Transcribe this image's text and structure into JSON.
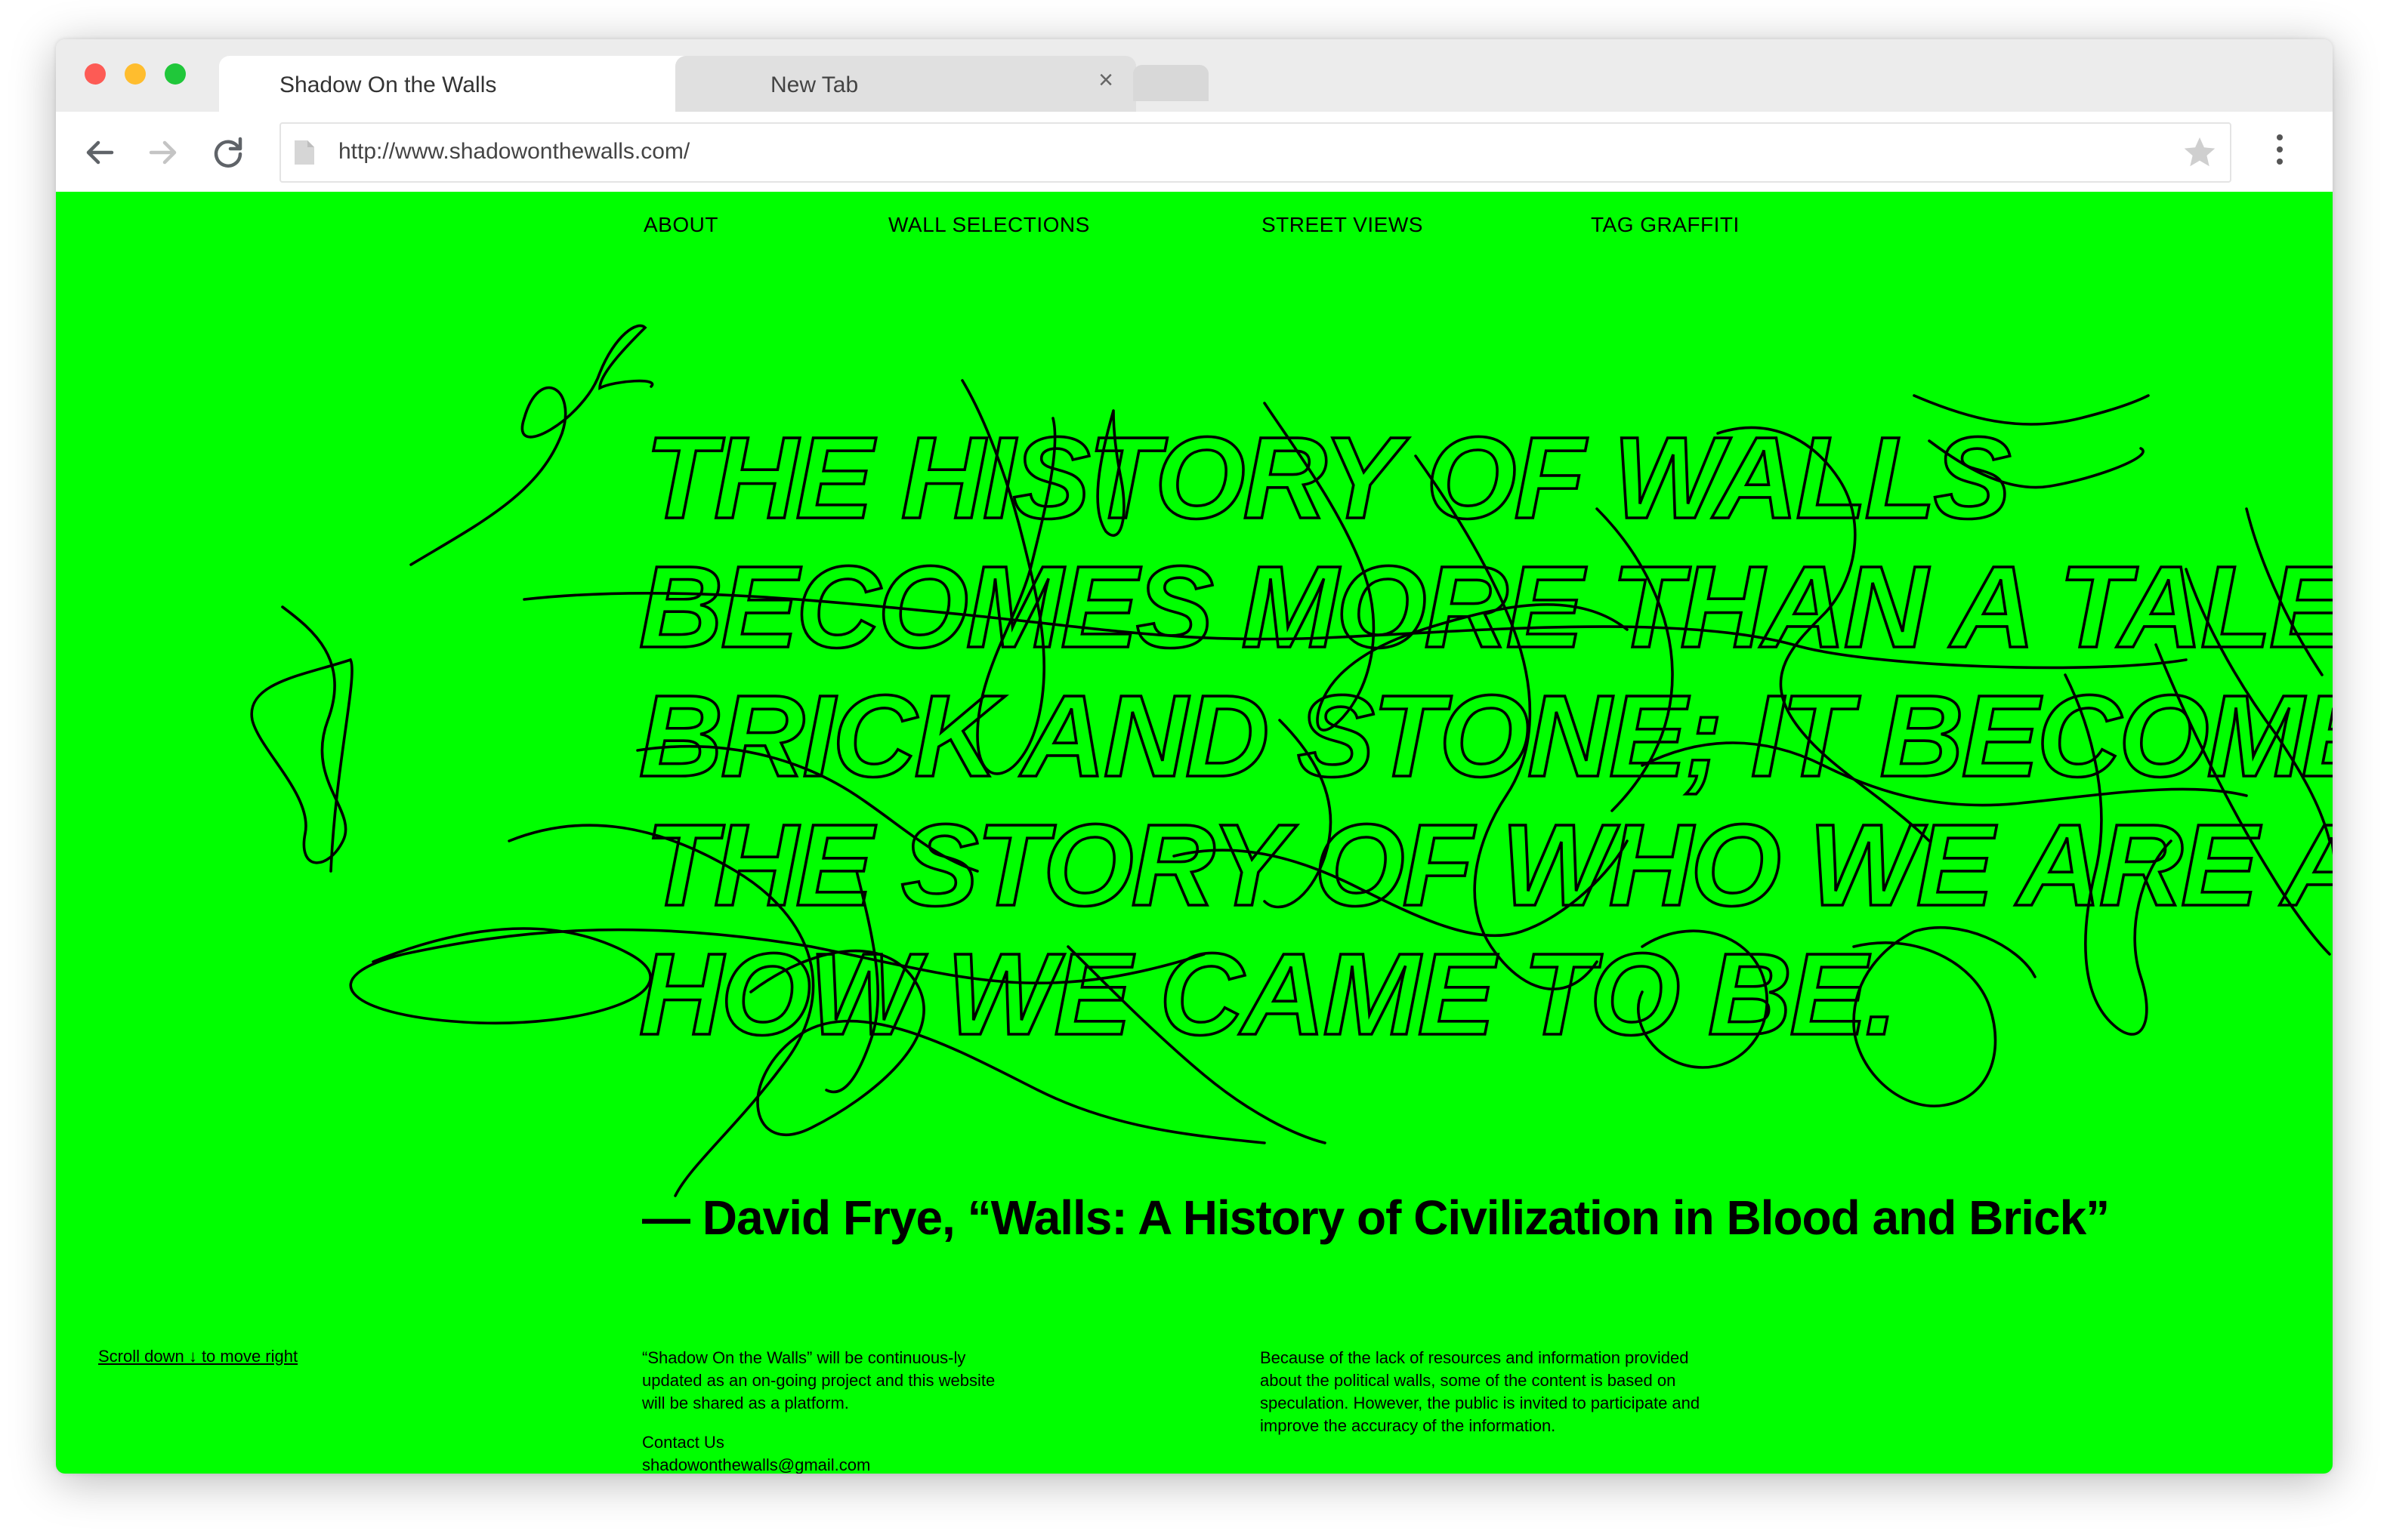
{
  "browser": {
    "tabs": [
      {
        "title": "Shadow On the Walls",
        "close_icon": "×",
        "active": true
      },
      {
        "title": "New Tab",
        "close_icon": "×",
        "active": false
      }
    ],
    "url": "http://www.shadowonthewalls.com/",
    "colors": {
      "page_background": "#00ff00",
      "ink": "#000000"
    }
  },
  "site": {
    "nav": [
      "ABOUT",
      "WALL SELECTIONS",
      "STREET VIEWS",
      "TAG GRAFFITI"
    ],
    "quote_lines": [
      "THE HISTORY OF WALLS",
      "BECOMES MORE THAN A TALE OF",
      "BRICK AND STONE; IT BECOMES",
      "THE STORY OF WHO WE ARE AND",
      "HOW WE CAME TO BE."
    ],
    "attribution": "— David Frye, “Walls: A History of Civilization in Blood and Brick”",
    "scroll_hint": "Scroll down ↓ to move right",
    "project_note": "“Shadow On the Walls” will be continuous-ly updated as an on-going project and this website will be shared as a platform.",
    "contact_label": "Contact Us",
    "contact_email": "shadowonthewalls@gmail.com",
    "disclaimer": "Because of the lack of resources and information provided about the political walls, some of the content is based on speculation. However, the public is invited to participate and improve the accuracy of the information."
  }
}
